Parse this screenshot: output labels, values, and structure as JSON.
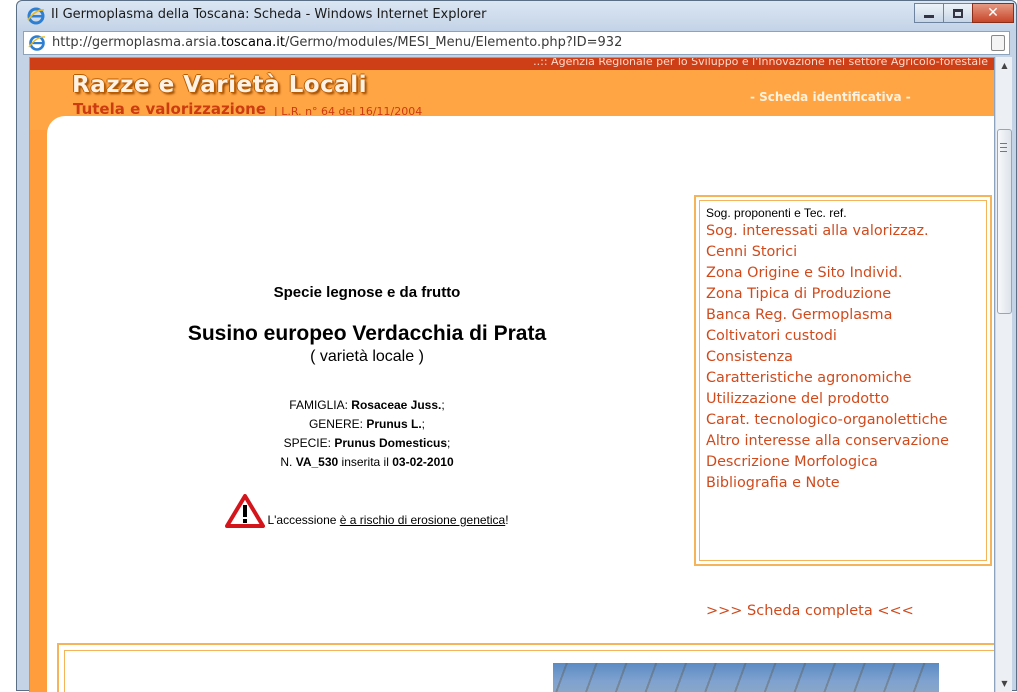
{
  "window": {
    "title": "Il Germoplasma della Toscana: Scheda - Windows Internet Explorer",
    "url_prefix": "http://germoplasma.arsia.",
    "url_domain": "toscana.it",
    "url_suffix": "/Germo/modules/MESI_Menu/Elemento.php?ID=932",
    "icons": {
      "browser": "ie-icon",
      "minimize": "minimize-icon",
      "maximize": "maximize-icon",
      "close": "close-icon"
    }
  },
  "header": {
    "agency": "..:: Agenzia Regionale per lo Sviluppo e l'Innovazione nel settore Agricolo-forestale",
    "logo_main": "Razze e Varietà Locali",
    "logo_sub": "Tutela e valorizzazione",
    "law": "| L.R. n° 64 del 16/11/2004",
    "scheda": "- Scheda identificativa -"
  },
  "record": {
    "category": "Specie legnose e da frutto",
    "name": "Susino europeo Verdacchia di Prata",
    "type": "( varietà locale )",
    "famiglia_label": "FAMIGLIA: ",
    "famiglia": "Rosaceae Juss.",
    "genere_label": "GENERE: ",
    "genere": "Prunus L.",
    "specie_label": "SPECIE: ",
    "specie": "Prunus Domesticus",
    "n_label": "N. ",
    "n": "VA_530",
    "inserita_label": " inserita il ",
    "date": "03-02-2010",
    "sep": ";",
    "warning_prefix": "L'accessione ",
    "warning_link": "è a rischio di erosione genetica",
    "warning_suffix": "!"
  },
  "menu": {
    "first": "Sog. proponenti e Tec. ref.",
    "items": [
      "Sog. interessati alla valorizzaz.",
      "Cenni Storici",
      "Zona Origine e Sito Individ.",
      "Zona Tipica di Produzione",
      "Banca Reg. Germoplasma",
      "Coltivatori custodi",
      "Consistenza",
      "Caratteristiche agronomiche",
      "Utilizzazione del prodotto",
      "Carat. tecnologico-organolettiche",
      "Altro interesse alla conservazione",
      "Descrizione Morfologica",
      "Bibliografia e Note"
    ]
  },
  "scheda_completa": ">>> Scheda completa <<<",
  "colors": {
    "accent": "#d14a1c",
    "orange": "#ffa544",
    "border": "#f6b45a",
    "topbar": "#cf3f17"
  }
}
